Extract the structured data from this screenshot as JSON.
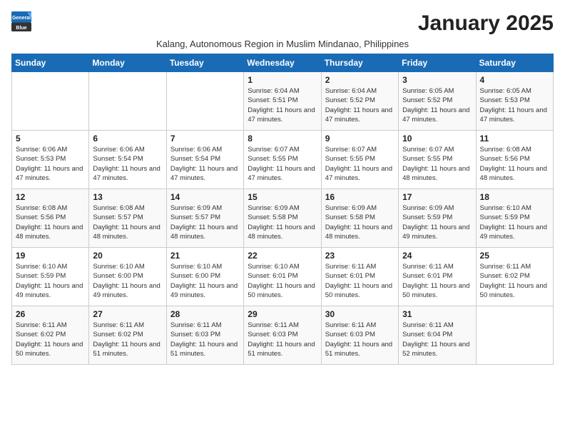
{
  "logo": {
    "line1": "General",
    "line2": "Blue"
  },
  "title": "January 2025",
  "subtitle": "Kalang, Autonomous Region in Muslim Mindanao, Philippines",
  "weekdays": [
    "Sunday",
    "Monday",
    "Tuesday",
    "Wednesday",
    "Thursday",
    "Friday",
    "Saturday"
  ],
  "weeks": [
    [
      {
        "day": "",
        "info": ""
      },
      {
        "day": "",
        "info": ""
      },
      {
        "day": "",
        "info": ""
      },
      {
        "day": "1",
        "info": "Sunrise: 6:04 AM\nSunset: 5:51 PM\nDaylight: 11 hours and 47 minutes."
      },
      {
        "day": "2",
        "info": "Sunrise: 6:04 AM\nSunset: 5:52 PM\nDaylight: 11 hours and 47 minutes."
      },
      {
        "day": "3",
        "info": "Sunrise: 6:05 AM\nSunset: 5:52 PM\nDaylight: 11 hours and 47 minutes."
      },
      {
        "day": "4",
        "info": "Sunrise: 6:05 AM\nSunset: 5:53 PM\nDaylight: 11 hours and 47 minutes."
      }
    ],
    [
      {
        "day": "5",
        "info": "Sunrise: 6:06 AM\nSunset: 5:53 PM\nDaylight: 11 hours and 47 minutes."
      },
      {
        "day": "6",
        "info": "Sunrise: 6:06 AM\nSunset: 5:54 PM\nDaylight: 11 hours and 47 minutes."
      },
      {
        "day": "7",
        "info": "Sunrise: 6:06 AM\nSunset: 5:54 PM\nDaylight: 11 hours and 47 minutes."
      },
      {
        "day": "8",
        "info": "Sunrise: 6:07 AM\nSunset: 5:55 PM\nDaylight: 11 hours and 47 minutes."
      },
      {
        "day": "9",
        "info": "Sunrise: 6:07 AM\nSunset: 5:55 PM\nDaylight: 11 hours and 47 minutes."
      },
      {
        "day": "10",
        "info": "Sunrise: 6:07 AM\nSunset: 5:55 PM\nDaylight: 11 hours and 48 minutes."
      },
      {
        "day": "11",
        "info": "Sunrise: 6:08 AM\nSunset: 5:56 PM\nDaylight: 11 hours and 48 minutes."
      }
    ],
    [
      {
        "day": "12",
        "info": "Sunrise: 6:08 AM\nSunset: 5:56 PM\nDaylight: 11 hours and 48 minutes."
      },
      {
        "day": "13",
        "info": "Sunrise: 6:08 AM\nSunset: 5:57 PM\nDaylight: 11 hours and 48 minutes."
      },
      {
        "day": "14",
        "info": "Sunrise: 6:09 AM\nSunset: 5:57 PM\nDaylight: 11 hours and 48 minutes."
      },
      {
        "day": "15",
        "info": "Sunrise: 6:09 AM\nSunset: 5:58 PM\nDaylight: 11 hours and 48 minutes."
      },
      {
        "day": "16",
        "info": "Sunrise: 6:09 AM\nSunset: 5:58 PM\nDaylight: 11 hours and 48 minutes."
      },
      {
        "day": "17",
        "info": "Sunrise: 6:09 AM\nSunset: 5:59 PM\nDaylight: 11 hours and 49 minutes."
      },
      {
        "day": "18",
        "info": "Sunrise: 6:10 AM\nSunset: 5:59 PM\nDaylight: 11 hours and 49 minutes."
      }
    ],
    [
      {
        "day": "19",
        "info": "Sunrise: 6:10 AM\nSunset: 5:59 PM\nDaylight: 11 hours and 49 minutes."
      },
      {
        "day": "20",
        "info": "Sunrise: 6:10 AM\nSunset: 6:00 PM\nDaylight: 11 hours and 49 minutes."
      },
      {
        "day": "21",
        "info": "Sunrise: 6:10 AM\nSunset: 6:00 PM\nDaylight: 11 hours and 49 minutes."
      },
      {
        "day": "22",
        "info": "Sunrise: 6:10 AM\nSunset: 6:01 PM\nDaylight: 11 hours and 50 minutes."
      },
      {
        "day": "23",
        "info": "Sunrise: 6:11 AM\nSunset: 6:01 PM\nDaylight: 11 hours and 50 minutes."
      },
      {
        "day": "24",
        "info": "Sunrise: 6:11 AM\nSunset: 6:01 PM\nDaylight: 11 hours and 50 minutes."
      },
      {
        "day": "25",
        "info": "Sunrise: 6:11 AM\nSunset: 6:02 PM\nDaylight: 11 hours and 50 minutes."
      }
    ],
    [
      {
        "day": "26",
        "info": "Sunrise: 6:11 AM\nSunset: 6:02 PM\nDaylight: 11 hours and 50 minutes."
      },
      {
        "day": "27",
        "info": "Sunrise: 6:11 AM\nSunset: 6:02 PM\nDaylight: 11 hours and 51 minutes."
      },
      {
        "day": "28",
        "info": "Sunrise: 6:11 AM\nSunset: 6:03 PM\nDaylight: 11 hours and 51 minutes."
      },
      {
        "day": "29",
        "info": "Sunrise: 6:11 AM\nSunset: 6:03 PM\nDaylight: 11 hours and 51 minutes."
      },
      {
        "day": "30",
        "info": "Sunrise: 6:11 AM\nSunset: 6:03 PM\nDaylight: 11 hours and 51 minutes."
      },
      {
        "day": "31",
        "info": "Sunrise: 6:11 AM\nSunset: 6:04 PM\nDaylight: 11 hours and 52 minutes."
      },
      {
        "day": "",
        "info": ""
      }
    ]
  ]
}
